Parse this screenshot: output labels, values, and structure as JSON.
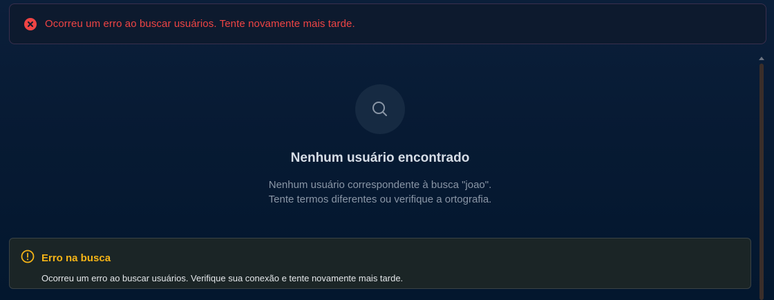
{
  "toast": {
    "message": "Ocorreu um erro ao buscar usuários. Tente novamente mais tarde.",
    "icon": "error-x-circle-icon",
    "color": "#ef4444"
  },
  "empty_state": {
    "icon": "search-icon",
    "title": "Nenhum usuário encontrado",
    "line1": "Nenhum usuário correspondente à busca \"joao\".",
    "line2": "Tente termos diferentes ou verifique a ortografia."
  },
  "warning_alert": {
    "icon": "alert-circle-icon",
    "title": "Erro na busca",
    "message": "Ocorreu um erro ao buscar usuários. Verifique sua conexão e tente novamente mais tarde.",
    "color": "#f5b417"
  }
}
